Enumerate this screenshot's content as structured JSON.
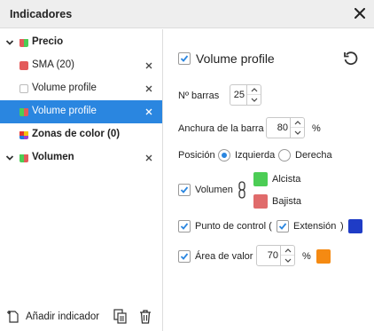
{
  "header": {
    "title": "Indicadores"
  },
  "tree": {
    "items": [
      {
        "label": "Precio",
        "icon_color": "#e35a5a"
      },
      {
        "label": "SMA (20)",
        "icon_color": "#e35a5a"
      },
      {
        "label": "Volume profile"
      },
      {
        "label": "Volume profile"
      },
      {
        "label": "Zonas de color (0)"
      },
      {
        "label": "Volumen"
      }
    ]
  },
  "footer": {
    "add_label": "Añadir indicador"
  },
  "settings": {
    "title": "Volume profile",
    "bars": {
      "label": "Nº barras",
      "value": "25"
    },
    "width": {
      "label": "Anchura de la barra",
      "value": "80",
      "unit": "%"
    },
    "position": {
      "label": "Posición",
      "left_label": "Izquierda",
      "right_label": "Derecha",
      "selected": "Izquierda"
    },
    "volume": {
      "label": "Volumen",
      "up_label": "Alcista",
      "down_label": "Bajista",
      "up_color": "#4ccd55",
      "down_color": "#e06b6b"
    },
    "control_point": {
      "label": "Punto de control (",
      "ext_label": "Extensión",
      "close_paren": ")",
      "color": "#1f3cc6"
    },
    "value_area": {
      "label": "Área de valor",
      "value": "70",
      "unit": "%",
      "color": "#f58a12"
    }
  },
  "colors": {
    "accent": "#2a86e0"
  }
}
